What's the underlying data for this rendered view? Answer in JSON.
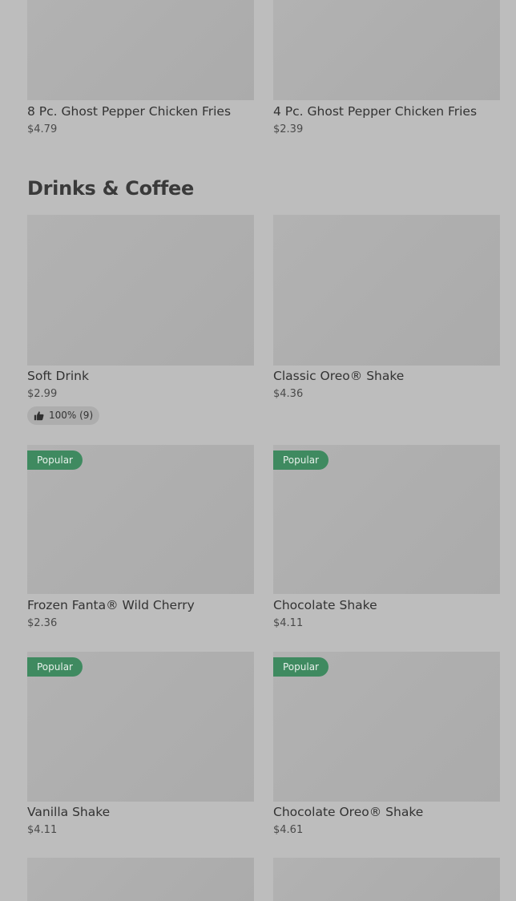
{
  "top_items": [
    {
      "name": "8 Pc. Ghost Pepper Chicken Fries",
      "price": "$4.79"
    },
    {
      "name": "4 Pc. Ghost Pepper Chicken Fries",
      "price": "$2.39"
    }
  ],
  "section": {
    "title": "Drinks & Coffee",
    "items": [
      {
        "name": "Soft Drink",
        "price": "$2.99",
        "rating": "100% (9)",
        "popular": false
      },
      {
        "name": "Classic Oreo® Shake",
        "price": "$4.36",
        "popular": false
      },
      {
        "name": "Frozen Fanta® Wild Cherry",
        "price": "$2.36",
        "popular": true
      },
      {
        "name": "Chocolate Shake",
        "price": "$4.11",
        "popular": true
      },
      {
        "name": "Vanilla Shake",
        "price": "$4.11",
        "popular": true
      },
      {
        "name": "Chocolate Oreo® Shake",
        "price": "$4.61",
        "popular": true
      }
    ]
  },
  "badge_label": "Popular",
  "colors": {
    "popular_badge": "#3f8a60",
    "background": "#bdbdbd",
    "image_placeholder": "#aeaeae"
  }
}
